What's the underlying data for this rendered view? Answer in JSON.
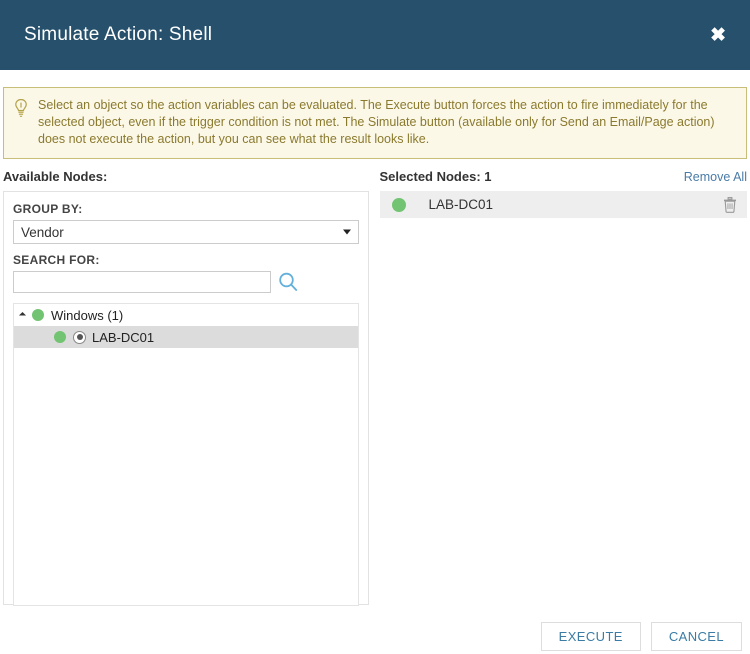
{
  "titlebar": {
    "title": "Simulate Action: Shell",
    "close_label": "✖"
  },
  "banner": {
    "icon": "lightbulb-icon",
    "text": "Select an object so the action variables can be evaluated. The Execute button forces the action to fire immediately for the selected object, even if the trigger condition is not met. The Simulate button (available only for Send an Email/Page action) does not execute the action, but you can see what the result looks like."
  },
  "available": {
    "heading": "Available Nodes:",
    "group_by_label": "GROUP BY:",
    "group_by_value": "Vendor",
    "search_label": "SEARCH FOR:",
    "search_value": "",
    "search_placeholder": "",
    "tree": [
      {
        "label": "Windows (1)",
        "type": "group",
        "status": "up"
      },
      {
        "label": "LAB-DC01",
        "type": "node",
        "status": "up",
        "selected": true
      }
    ]
  },
  "selected": {
    "heading": "Selected Nodes: 1",
    "count": 1,
    "remove_all_label": "Remove All",
    "items": [
      {
        "label": "LAB-DC01",
        "status": "up",
        "remove_icon": "trash-icon"
      }
    ]
  },
  "footer": {
    "execute_label": "EXECUTE",
    "cancel_label": "CANCEL"
  },
  "colors": {
    "header_bg": "#26506b",
    "banner_bg": "#fcf8e8",
    "banner_border": "#c9bd7a",
    "banner_text": "#8a7a2e",
    "status_up": "#72c472",
    "link": "#4a7ba7",
    "button_text": "#3a7ca5",
    "row_selected": "#dcdcdc"
  }
}
